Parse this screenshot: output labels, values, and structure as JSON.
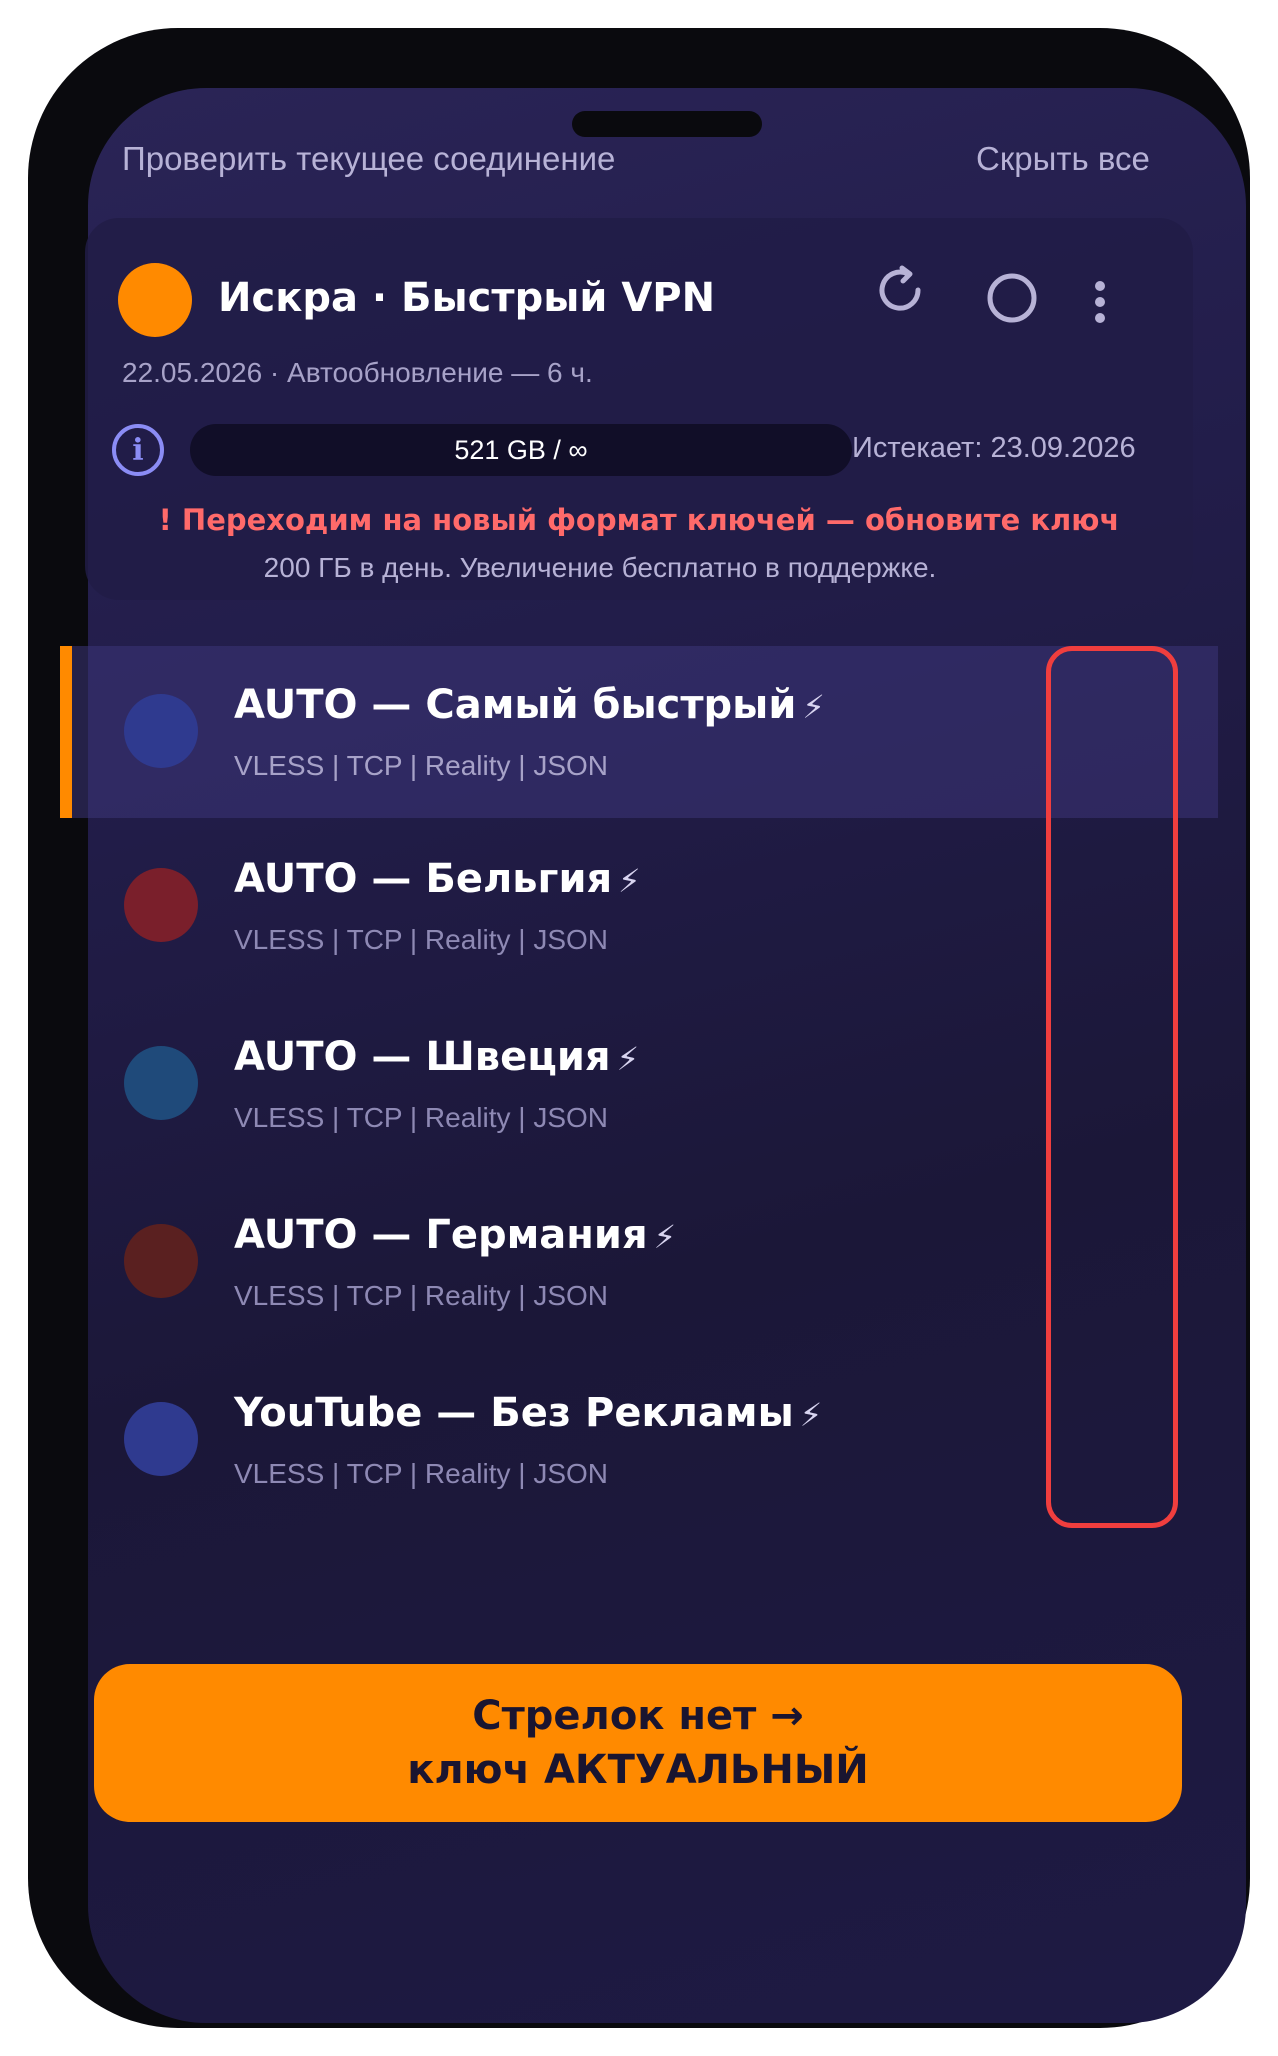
{
  "top_bar": {
    "check_connection": "Проверить текущее соединение",
    "hide_all": "Скрыть все"
  },
  "subscription": {
    "title": "Искра · Быстрый VPN",
    "updated": "22.05.2026 · Автообновление — 6 ч.",
    "traffic": "521 GB / ∞",
    "expires": "Истекает: 23.09.2026",
    "info_icon_glyph": "i",
    "warning": "! Переходим на новый формат ключей — обновите ключ",
    "warning_sub": "200 ГБ в день. Увеличение бесплатно в поддержке.",
    "accent_color": "#ff8a00",
    "icons": [
      "refresh-icon",
      "power-circle-icon",
      "more-vertical-icon"
    ]
  },
  "servers": [
    {
      "name": "AUTO — Самый быстрый",
      "bolt": "⚡",
      "protocol": "VLESS | TCP | Reality | JSON",
      "selected": true,
      "flag_color": "#2f3a8f"
    },
    {
      "name": "AUTO — Бельгия",
      "bolt": "⚡",
      "protocol": "VLESS | TCP | Reality | JSON",
      "selected": false,
      "flag_color": "#7a1f2b"
    },
    {
      "name": "AUTO — Швеция",
      "bolt": "⚡",
      "protocol": "VLESS | TCP | Reality | JSON",
      "selected": false,
      "flag_color": "#1f4a7a"
    },
    {
      "name": "AUTO — Германия",
      "bolt": "⚡",
      "protocol": "VLESS | TCP | Reality | JSON",
      "selected": false,
      "flag_color": "#5a2020"
    },
    {
      "name": "YouTube — Без Рекламы",
      "bolt": "⚡",
      "protocol": "VLESS | TCP | Reality | JSON",
      "selected": false,
      "flag_color": "#2f3a8f"
    }
  ],
  "cta": {
    "line1": "Стрелок нет →",
    "line2": "ключ АКТУАЛЬНЫЙ"
  }
}
